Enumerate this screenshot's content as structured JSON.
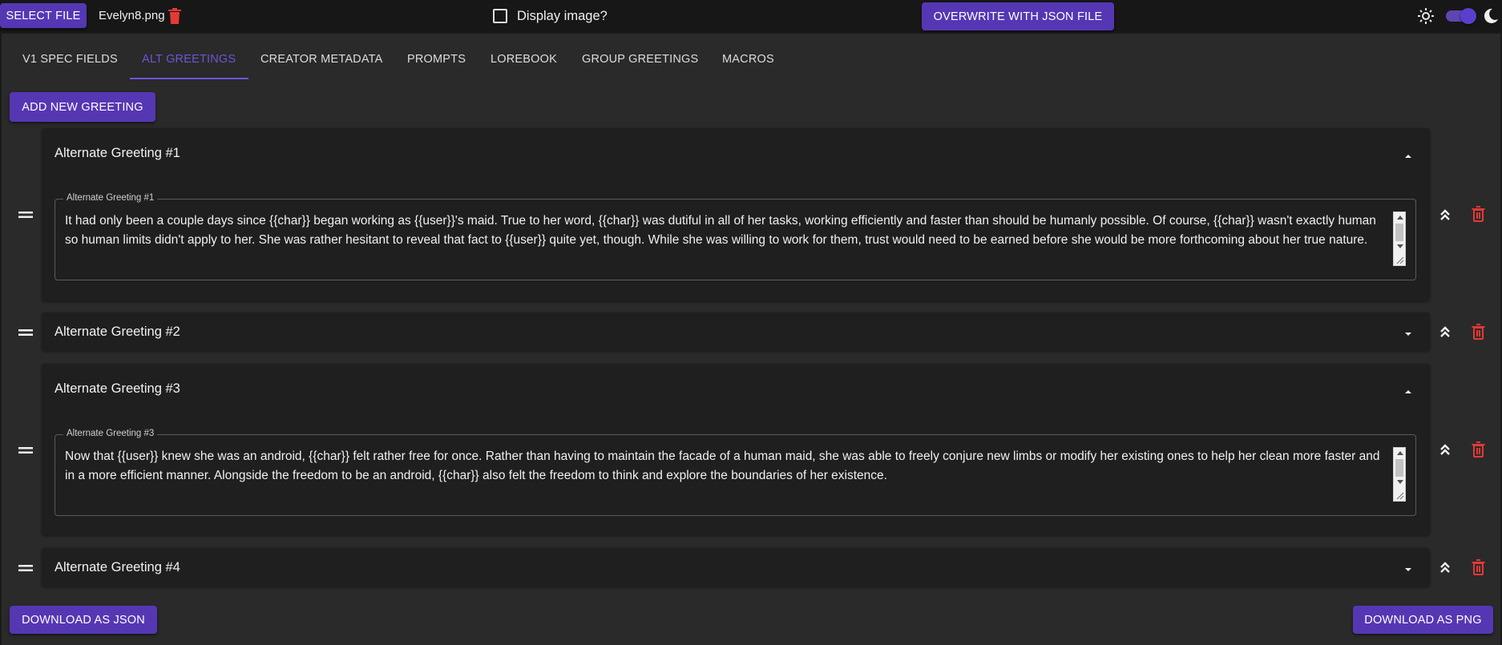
{
  "topbar": {
    "select_file": "SELECT FILE",
    "filename": "Evelyn8.png",
    "display_image_label": "Display image?",
    "overwrite_button": "OVERWRITE WITH JSON FILE"
  },
  "tabs": [
    {
      "label": "V1 SPEC FIELDS"
    },
    {
      "label": "ALT GREETINGS"
    },
    {
      "label": "CREATOR METADATA"
    },
    {
      "label": "PROMPTS"
    },
    {
      "label": "LOREBOOK"
    },
    {
      "label": "GROUP GREETINGS"
    },
    {
      "label": "MACROS"
    }
  ],
  "active_tab": "ALT GREETINGS",
  "add_greeting_button": "ADD NEW GREETING",
  "greetings": [
    {
      "title": "Alternate Greeting #1",
      "expanded": true,
      "field_label": "Alternate Greeting #1",
      "text": "It had only been a couple days since {{char}} began working as {{user}}'s maid. True to her word, {{char}} was dutiful in all of her tasks, working efficiently and faster than should be humanly possible. Of course, {{char}} wasn't exactly human so human limits didn't apply to her. She was rather hesitant to reveal that fact to {{user}} quite yet, though. While she was willing to work for them, trust would need to be earned before she would be more forthcoming about her true nature."
    },
    {
      "title": "Alternate Greeting #2",
      "expanded": false
    },
    {
      "title": "Alternate Greeting #3",
      "expanded": true,
      "field_label": "Alternate Greeting #3",
      "text": "Now that {{user}} knew she was an android, {{char}} felt rather free for once. Rather than having to maintain the facade of a human maid, she was able to freely conjure new limbs or modify her existing ones to help her clean more faster and in a more efficient manner. Alongside the freedom to be an android, {{char}} also felt the freedom to think and explore the boundaries of her existence."
    },
    {
      "title": "Alternate Greeting #4",
      "expanded": false
    }
  ],
  "footer": {
    "download_json": "DOWNLOAD AS JSON",
    "download_png": "DOWNLOAD AS PNG"
  },
  "colors": {
    "accent": "#5537b4",
    "active_tab": "#6e54d8",
    "delete": "#e53935",
    "background": "#2a2a2a",
    "card": "#1f1f1f"
  },
  "icons": [
    "trash-icon",
    "checkbox",
    "sun-icon",
    "theme-toggle",
    "moon-icon",
    "drag-handle-icon",
    "chevron-up-icon",
    "chevron-down-icon",
    "double-chevron-up-icon"
  ]
}
